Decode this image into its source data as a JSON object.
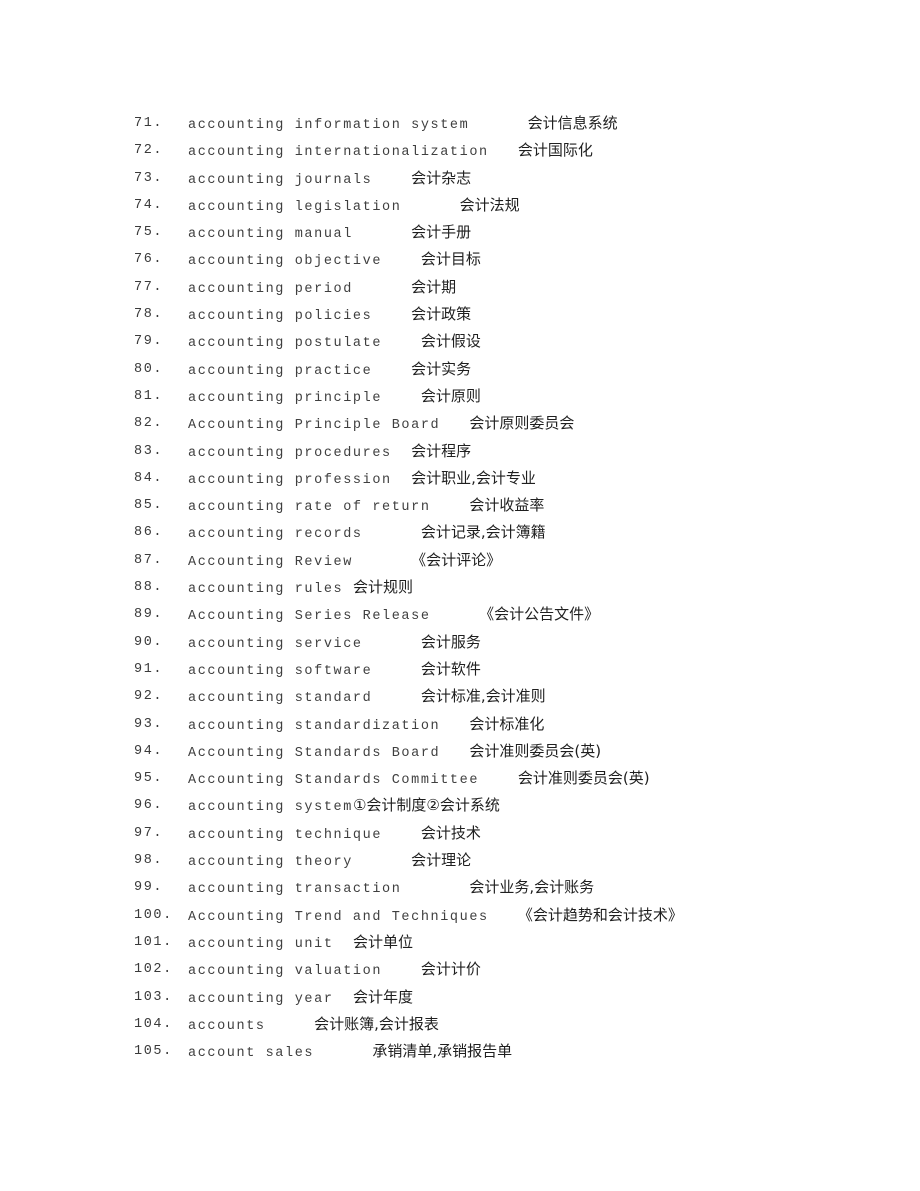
{
  "document": {
    "type": "bilingual-glossary",
    "subject": "accounting terminology English-Chinese glossary",
    "page_background": "#ffffff",
    "text_color_english": "#3f3f3f",
    "text_color_chinese": "#1f1f1f",
    "entries": [
      {
        "number": "71.",
        "english": "accounting information system",
        "gap": "      ",
        "chinese": "会计信息系统"
      },
      {
        "number": "72.",
        "english": "accounting internationalization",
        "gap": "   ",
        "chinese": "会计国际化"
      },
      {
        "number": "73.",
        "english": "accounting journals",
        "gap": "    ",
        "chinese": "会计杂志"
      },
      {
        "number": "74.",
        "english": "accounting legislation",
        "gap": "      ",
        "chinese": "会计法规"
      },
      {
        "number": "75.",
        "english": "accounting manual",
        "gap": "      ",
        "chinese": "会计手册"
      },
      {
        "number": "76.",
        "english": "accounting objective",
        "gap": "    ",
        "chinese": "会计目标"
      },
      {
        "number": "77.",
        "english": "accounting period",
        "gap": "      ",
        "chinese": "会计期"
      },
      {
        "number": "78.",
        "english": "accounting policies",
        "gap": "    ",
        "chinese": "会计政策"
      },
      {
        "number": "79.",
        "english": "accounting postulate",
        "gap": "    ",
        "chinese": "会计假设"
      },
      {
        "number": "80.",
        "english": "accounting practice",
        "gap": "    ",
        "chinese": "会计实务"
      },
      {
        "number": "81.",
        "english": "accounting principle",
        "gap": "    ",
        "chinese": "会计原则"
      },
      {
        "number": "82.",
        "english": "Accounting Principle Board",
        "gap": "   ",
        "chinese": "会计原则委员会"
      },
      {
        "number": "83.",
        "english": "accounting procedures",
        "gap": "  ",
        "chinese": "会计程序"
      },
      {
        "number": "84.",
        "english": "accounting profession",
        "gap": "  ",
        "chinese": "会计职业,会计专业"
      },
      {
        "number": "85.",
        "english": "accounting rate of return",
        "gap": "    ",
        "chinese": "会计收益率"
      },
      {
        "number": "86.",
        "english": "accounting records",
        "gap": "      ",
        "chinese": "会计记录,会计簿籍"
      },
      {
        "number": "87.",
        "english": "Accounting Review",
        "gap": "      ",
        "chinese": "《会计评论》"
      },
      {
        "number": "88.",
        "english": "accounting rules",
        "gap": " ",
        "chinese": "会计规则"
      },
      {
        "number": "89.",
        "english": "Accounting Series Release",
        "gap": "     ",
        "chinese": "《会计公告文件》"
      },
      {
        "number": "90.",
        "english": "accounting service",
        "gap": "      ",
        "chinese": "会计服务"
      },
      {
        "number": "91.",
        "english": "accounting software",
        "gap": "     ",
        "chinese": "会计软件"
      },
      {
        "number": "92.",
        "english": "accounting standard",
        "gap": "     ",
        "chinese": "会计标准,会计准则"
      },
      {
        "number": "93.",
        "english": "accounting standardization",
        "gap": "   ",
        "chinese": "会计标准化"
      },
      {
        "number": "94.",
        "english": "Accounting Standards Board",
        "gap": "   ",
        "chinese": "会计准则委员会(英)"
      },
      {
        "number": "95.",
        "english": "Accounting Standards Committee",
        "gap": "    ",
        "chinese": "会计准则委员会(英)"
      },
      {
        "number": "96.",
        "english": "accounting system",
        "gap": "",
        "chinese": "①会计制度②会计系统"
      },
      {
        "number": "97.",
        "english": "accounting technique",
        "gap": "    ",
        "chinese": "会计技术"
      },
      {
        "number": "98.",
        "english": "accounting theory",
        "gap": "      ",
        "chinese": "会计理论"
      },
      {
        "number": "99.",
        "english": "accounting transaction",
        "gap": "       ",
        "chinese": "会计业务,会计账务"
      },
      {
        "number": "100.",
        "english": "Accounting Trend and Techniques",
        "gap": "   ",
        "chinese": "《会计趋势和会计技术》"
      },
      {
        "number": "101.",
        "english": "accounting unit",
        "gap": "  ",
        "chinese": "会计单位"
      },
      {
        "number": "102.",
        "english": "accounting valuation",
        "gap": "    ",
        "chinese": "会计计价"
      },
      {
        "number": "103.",
        "english": "accounting year",
        "gap": "  ",
        "chinese": "会计年度"
      },
      {
        "number": "104.",
        "english": "accounts",
        "gap": "     ",
        "chinese": "会计账簿,会计报表"
      },
      {
        "number": "105.",
        "english": "account sales",
        "gap": "      ",
        "chinese": "承销清单,承销报告单"
      }
    ]
  }
}
